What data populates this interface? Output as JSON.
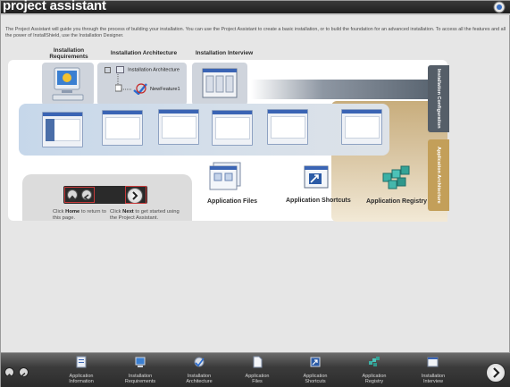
{
  "header": {
    "title": "project assistant",
    "intro_text": "The Project Assistant will guide you through the process of building your installation. You can use the Project Assistant to create a basic installation, or to build the foundation for an advanced installation. To access all the features and all the power of InstallShield, use the Installation Designer."
  },
  "columns": {
    "requirements": "Installation Requirements",
    "architecture": "Installation Architecture",
    "interview": "Installation Interview"
  },
  "architecture_tree": {
    "root": "Installation Architecture",
    "feature": "NewFeature1"
  },
  "side_tabs": {
    "configuration": "Installation Configuration",
    "application": "Application Architecture"
  },
  "app_items": {
    "files": "Application Files",
    "shortcuts": "Application Shortcuts",
    "registry": "Application Registry"
  },
  "nav_help": {
    "home_prefix": "Click ",
    "home_bold": "Home",
    "home_suffix": " to return to this page.",
    "next_prefix": "Click ",
    "next_bold": "Next",
    "next_suffix": " to get started using the Project Assistant."
  },
  "footer": {
    "items": [
      {
        "label1": "Application",
        "label2": "Information",
        "icon": "application-information-icon"
      },
      {
        "label1": "Installation",
        "label2": "Requirements",
        "icon": "installation-requirements-icon"
      },
      {
        "label1": "Installation",
        "label2": "Architecture",
        "icon": "installation-architecture-icon"
      },
      {
        "label1": "Application",
        "label2": "Files",
        "icon": "application-files-icon"
      },
      {
        "label1": "Application",
        "label2": "Shortcuts",
        "icon": "application-shortcuts-icon"
      },
      {
        "label1": "Application",
        "label2": "Registry",
        "icon": "application-registry-icon"
      },
      {
        "label1": "Installation",
        "label2": "Interview",
        "icon": "installation-interview-icon"
      }
    ]
  },
  "colors": {
    "accent_gold": "#c39f59",
    "config_tab": "#555e68",
    "nav_highlight": "#c63b3b"
  }
}
